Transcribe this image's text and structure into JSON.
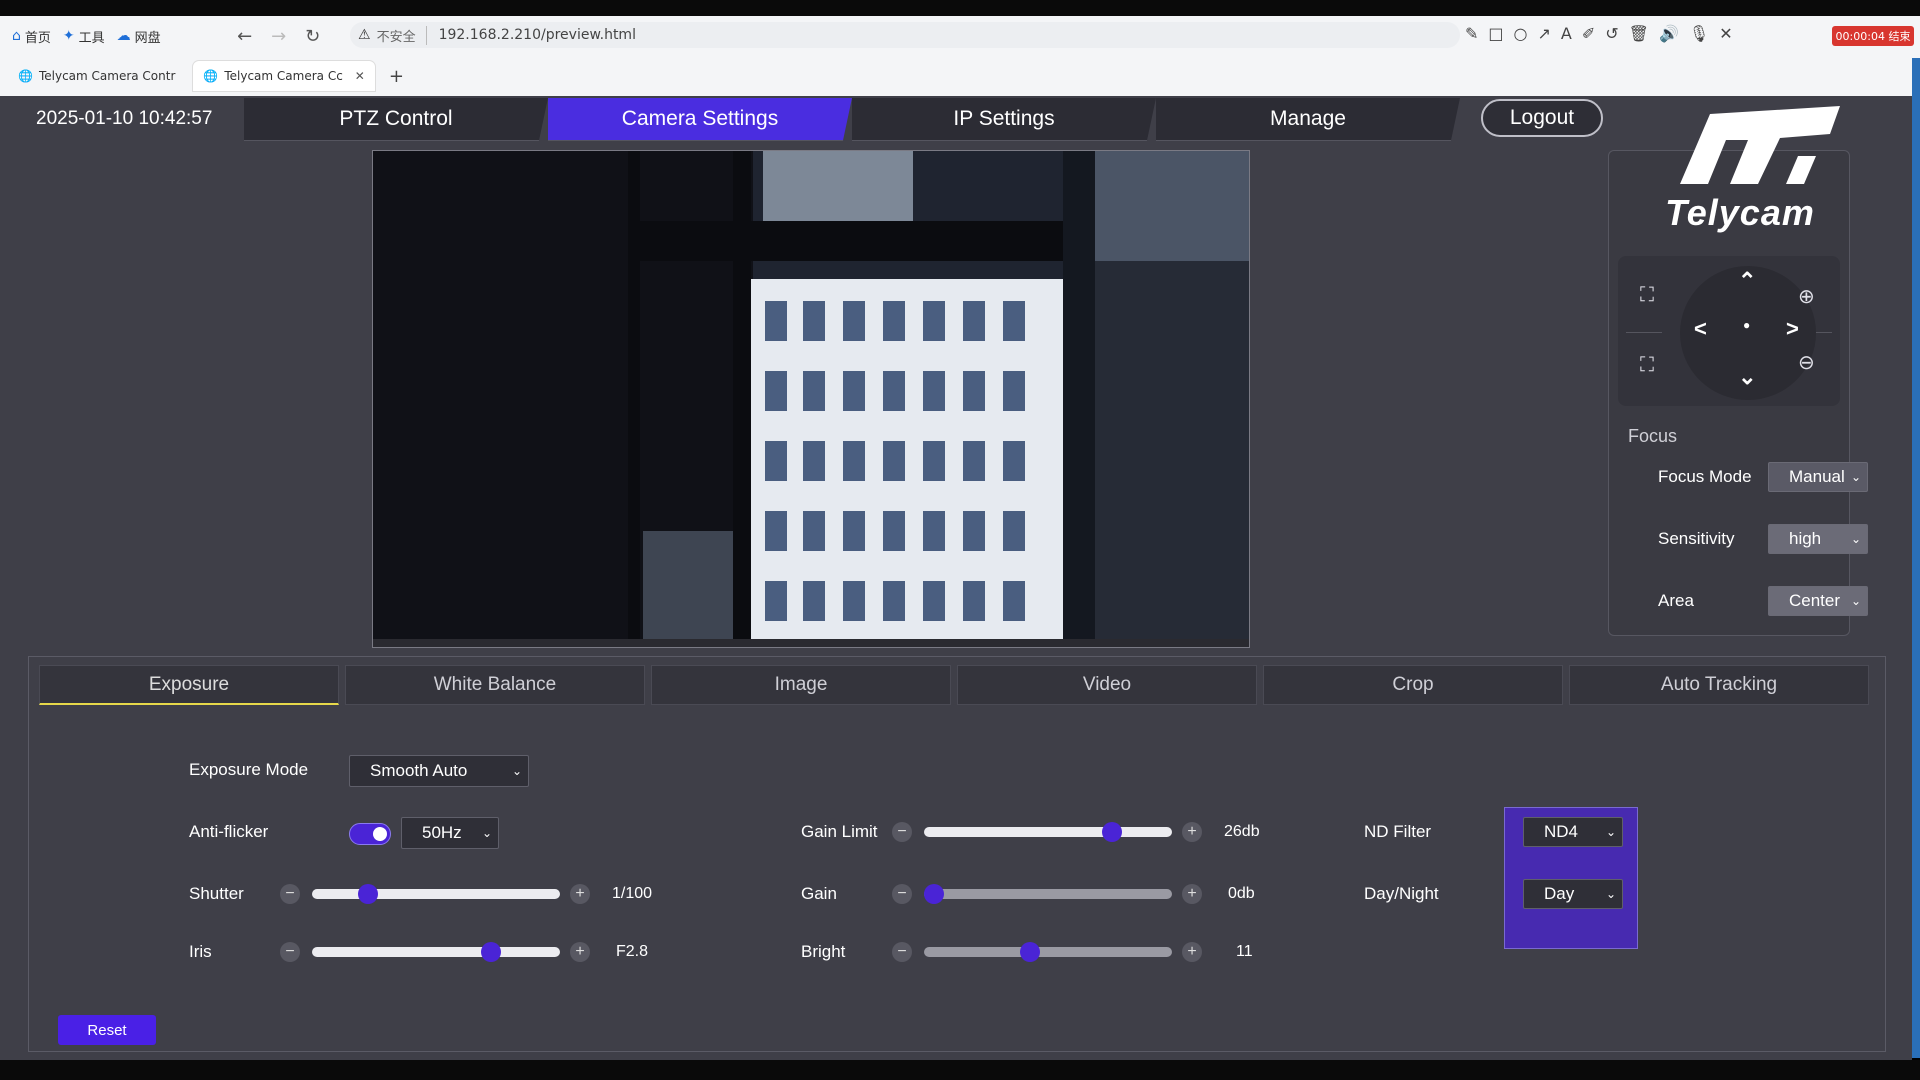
{
  "browser": {
    "toolbar_items": [
      {
        "label": "首页",
        "icon": "home-icon"
      },
      {
        "label": "工具",
        "icon": "tools-icon"
      },
      {
        "label": "网盘",
        "icon": "cloud-drive-icon"
      }
    ],
    "security_label": "不安全",
    "url": "192.168.2.210/preview.html",
    "recording_badge": "00:00:04 结束",
    "tabs": [
      {
        "title": "Telycam Camera Contr"
      },
      {
        "title": "Telycam Camera Cc"
      }
    ],
    "new_tab": "+"
  },
  "header": {
    "datetime": "2025-01-10 10:42:57",
    "nav_tabs": [
      {
        "label": "PTZ Control"
      },
      {
        "label": "Camera Settings"
      },
      {
        "label": "IP Settings"
      },
      {
        "label": "Manage"
      }
    ],
    "active_tab": "Camera Settings",
    "logout_label": "Logout",
    "accent_color": "#4a2de0"
  },
  "brand": {
    "name": "Telycam"
  },
  "ptz": {
    "controls": [
      "focus-expand-icon",
      "focus-shrink-icon",
      "arrow-up-icon",
      "arrow-down-icon",
      "arrow-left-icon",
      "arrow-right-icon",
      "home-dot-icon",
      "zoom-in-icon",
      "zoom-out-icon"
    ]
  },
  "focus": {
    "title": "Focus",
    "mode_label": "Focus Mode",
    "mode_value": "Manual",
    "sensitivity_label": "Sensitivity",
    "sensitivity_value": "high",
    "area_label": "Area",
    "area_value": "Center"
  },
  "settings": {
    "tabs": [
      {
        "label": "Exposure"
      },
      {
        "label": "White Balance"
      },
      {
        "label": "Image"
      },
      {
        "label": "Video"
      },
      {
        "label": "Crop"
      },
      {
        "label": "Auto Tracking"
      }
    ],
    "active_tab": "Exposure",
    "exposure_mode_label": "Exposure Mode",
    "exposure_mode_value": "Smooth Auto",
    "antiflicker_label": "Anti-flicker",
    "antiflicker_enabled": true,
    "antiflicker_value": "50Hz",
    "shutter_label": "Shutter",
    "shutter_value": "1/100",
    "shutter_level": 0.2,
    "iris_label": "Iris",
    "iris_value": "F2.8",
    "iris_level": 0.74,
    "gain_limit_label": "Gain Limit",
    "gain_limit_value": "26db",
    "gain_limit_level": 0.78,
    "gain_label": "Gain",
    "gain_value": "0db",
    "gain_level": 0.0,
    "bright_label": "Bright",
    "bright_value": "11",
    "bright_level": 0.42,
    "nd_filter_label": "ND Filter",
    "nd_filter_value": "ND4",
    "day_night_label": "Day/Night",
    "day_night_value": "Day",
    "reset_label": "Reset"
  }
}
